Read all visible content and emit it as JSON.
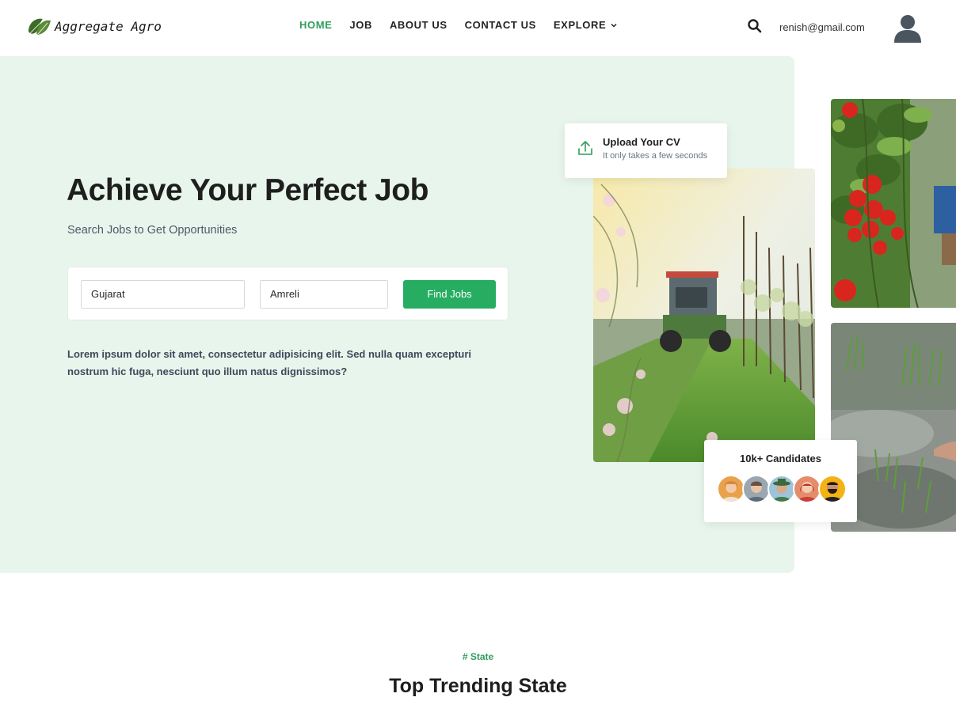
{
  "brand": {
    "name": "Aggregate Agro",
    "logo_icon": "leaf-icon",
    "accent": "#26ad62"
  },
  "nav": {
    "items": [
      {
        "label": "HOME",
        "active": true
      },
      {
        "label": "JOB",
        "active": false
      },
      {
        "label": "ABOUT US",
        "active": false
      },
      {
        "label": "CONTACT US",
        "active": false
      },
      {
        "label": "EXPLORE",
        "active": false
      }
    ],
    "search_icon": "search-icon",
    "user_email": "renish@gmail.com",
    "avatar_icon": "user-avatar-icon"
  },
  "hero": {
    "title": "Achieve Your Perfect Job",
    "subtitle": "Search Jobs to Get Opportunities",
    "search": {
      "state_value": "Gujarat",
      "city_value": "Amreli",
      "button_label": "Find Jobs"
    },
    "description": "Lorem ipsum dolor sit amet, consectetur adipisicing elit. Sed nulla quam excepturi nostrum hic fuga, nesciunt quo illum natus dignissimos?",
    "upload_card": {
      "title": "Upload Your CV",
      "subtitle": "It only takes a few seconds",
      "icon": "upload-icon"
    },
    "candidates_card": {
      "title": "10k+ Candidates"
    }
  },
  "section": {
    "tag": "# State",
    "title_bold": "Top Trending",
    "title_rest": " State"
  }
}
